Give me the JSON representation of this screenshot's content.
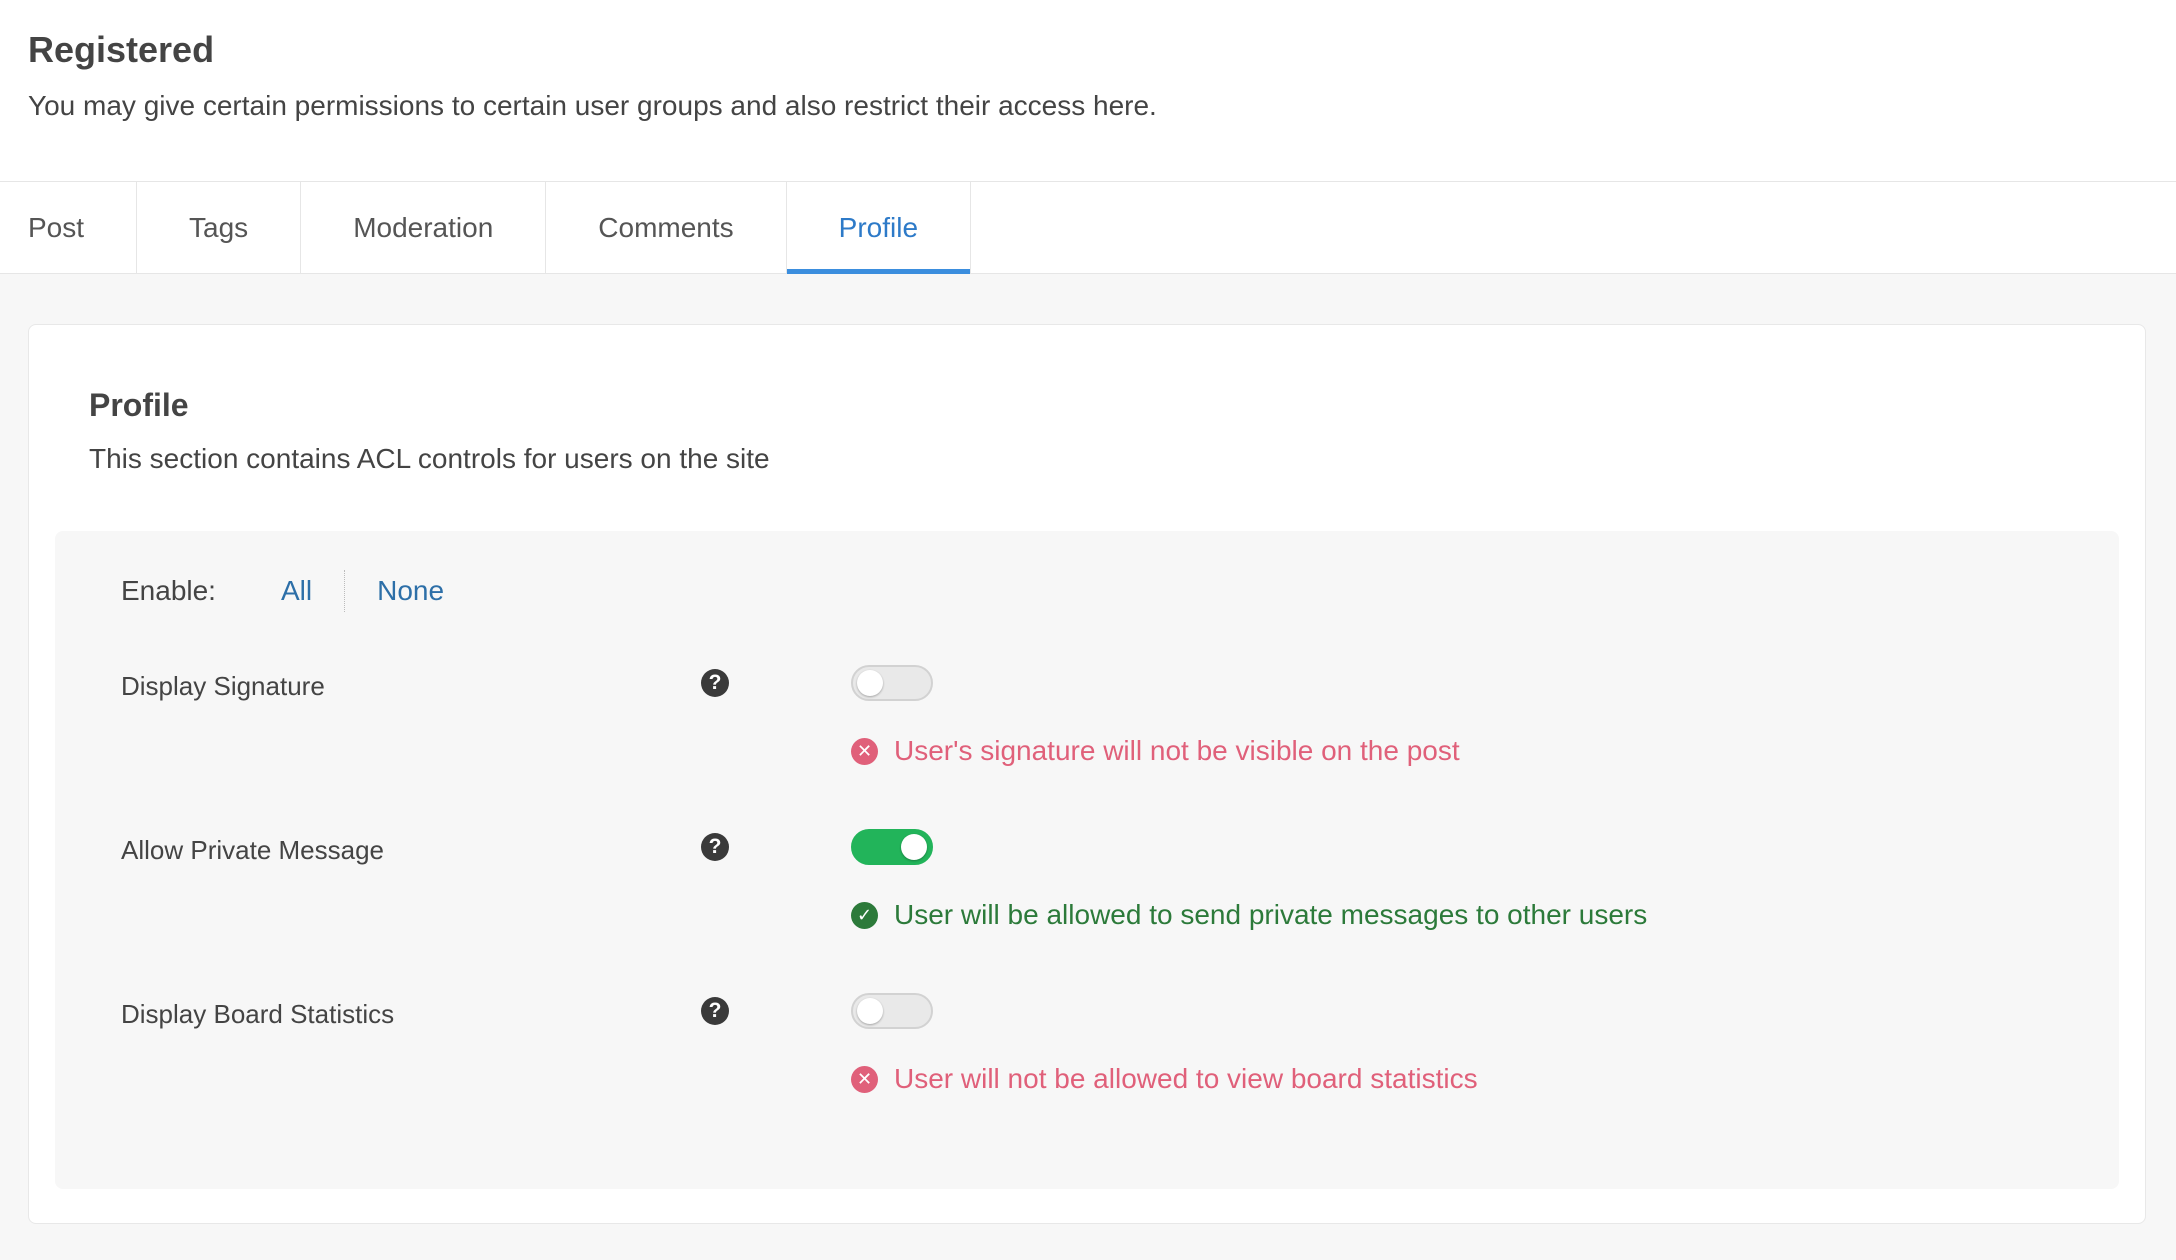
{
  "header": {
    "title": "Registered",
    "description": "You may give certain permissions to certain user groups and also restrict their access here."
  },
  "tabs": [
    {
      "label": "Post",
      "active": false
    },
    {
      "label": "Tags",
      "active": false
    },
    {
      "label": "Moderation",
      "active": false
    },
    {
      "label": "Comments",
      "active": false
    },
    {
      "label": "Profile",
      "active": true
    }
  ],
  "section": {
    "title": "Profile",
    "description": "This section contains ACL controls for users on the site"
  },
  "enable": {
    "label": "Enable:",
    "all": "All",
    "none": "None"
  },
  "permissions": [
    {
      "label": "Display Signature",
      "enabled": false,
      "message": "User's signature will not be visible on the post"
    },
    {
      "label": "Allow Private Message",
      "enabled": true,
      "message": "User will be allowed to send private messages to other users"
    },
    {
      "label": "Display Board Statistics",
      "enabled": false,
      "message": "User will not be allowed to view board statistics"
    }
  ],
  "icons": {
    "help": "question-circle-icon",
    "negative": "x-circle-icon",
    "positive": "check-circle-icon"
  },
  "colors": {
    "accent": "#2d7ac8",
    "toggle_on": "#22b45a",
    "negative": "#e0607a",
    "positive": "#2c7a3a"
  }
}
